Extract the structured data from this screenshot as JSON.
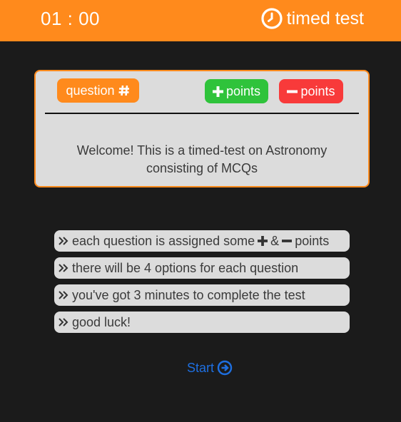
{
  "header": {
    "timer": "01 : 00",
    "title": "timed test",
    "icon": "clock-icon",
    "background": "#ff8a1c"
  },
  "card": {
    "question_label": "question",
    "question_icon": "hash-icon",
    "plus_label": "points",
    "plus_icon": "plus-icon",
    "minus_label": "points",
    "minus_icon": "minus-icon",
    "welcome_text": "Welcome! This is a timed-test on Astronomy consisting of MCQs",
    "colors": {
      "border": "#ff8a1c",
      "question": "#ff8a1c",
      "plus": "#2fc33b",
      "minus": "#f83a3a",
      "card_bg": "#dcdcdc"
    }
  },
  "info": {
    "bullet_icon": "double-chevron-right-icon",
    "items": [
      {
        "text_before": "each question is assigned some",
        "icon1": "plus-icon",
        "text_between": "&",
        "icon2": "minus-icon",
        "text_after": "points"
      },
      {
        "text": "there will be 4 options for each question"
      },
      {
        "text": "you've got 3 minutes to complete the test"
      },
      {
        "text": "good luck!"
      }
    ]
  },
  "start": {
    "label": "Start",
    "icon": "arrow-circle-right-icon",
    "color": "#1e6fe0"
  }
}
